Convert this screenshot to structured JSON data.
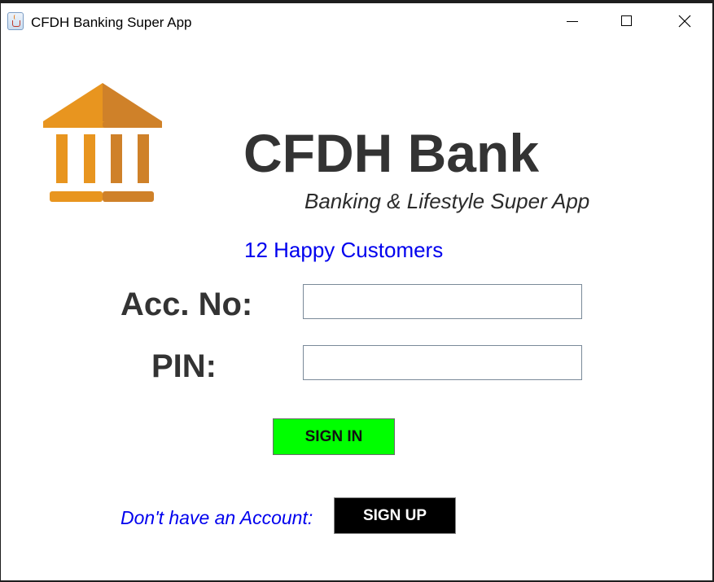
{
  "window": {
    "title": "CFDH Banking Super App",
    "icon": "java-cup-icon"
  },
  "header": {
    "bank_name": "CFDH Bank",
    "tagline": "Banking & Lifestyle Super App",
    "logo_icon": "bank-building-icon",
    "customers_text": "12 Happy Customers"
  },
  "login": {
    "account_label": "Acc. No:",
    "account_value": "",
    "pin_label": "PIN:",
    "pin_value": "",
    "signin_label": "SIGN IN"
  },
  "signup": {
    "prompt": "Don't have an Account:",
    "button_label": "SIGN UP"
  },
  "colors": {
    "logo_light": "#e8951f",
    "logo_dark": "#d0822a",
    "signin_bg": "#00ff00",
    "signup_bg": "#000000",
    "link_blue": "#0000ee",
    "heading": "#333333"
  }
}
